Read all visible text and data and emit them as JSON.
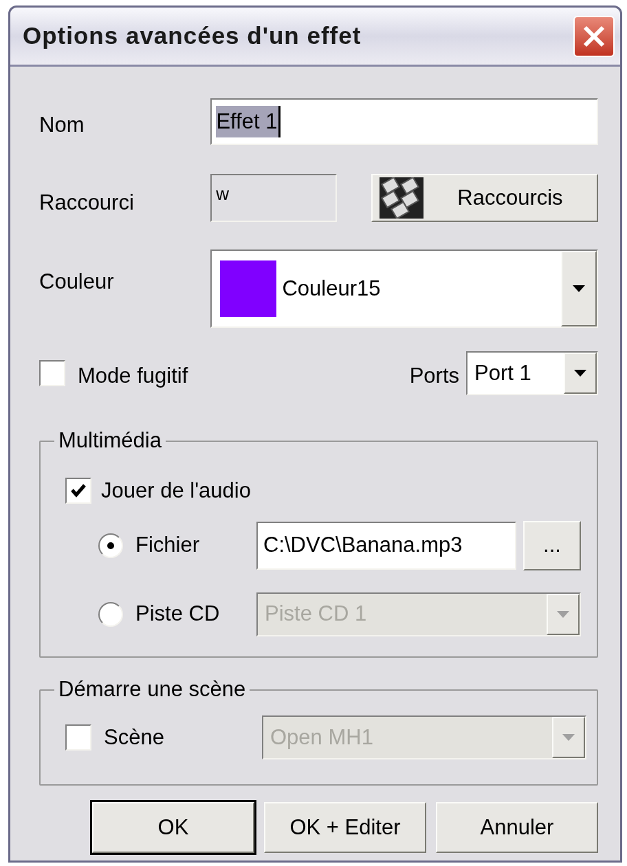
{
  "window": {
    "title": "Options avancées d'un effet"
  },
  "name": {
    "label": "Nom",
    "value": "Effet 1"
  },
  "shortcut": {
    "label": "Raccourci",
    "value": "w",
    "button": "Raccourcis"
  },
  "color": {
    "label": "Couleur",
    "value": "Couleur15",
    "color": "#8000ff"
  },
  "fugitive": {
    "label": "Mode fugitif",
    "checked": false
  },
  "ports": {
    "label": "Ports",
    "value": "Port 1"
  },
  "multimedia": {
    "title": "Multimédia",
    "play_audio": {
      "label": "Jouer de l'audio",
      "checked": true
    },
    "sources": [
      {
        "label": "Fichier",
        "selected": true,
        "kind": "file",
        "value": "C:\\DVC\\Banana.mp3",
        "button": "...",
        "disabled": false
      },
      {
        "label": "Piste CD",
        "selected": false,
        "kind": "dropdown",
        "value": "Piste CD 1",
        "disabled": true
      }
    ]
  },
  "scene_group": {
    "title": "Démarre une scène",
    "scene": {
      "label": "Scène",
      "checked": false
    },
    "dropdown": {
      "value": "Open MH1",
      "disabled": true
    }
  },
  "buttons": [
    {
      "label": "OK",
      "default": true
    },
    {
      "label": "OK + Editer",
      "default": false
    },
    {
      "label": "Annuler",
      "default": false
    }
  ]
}
